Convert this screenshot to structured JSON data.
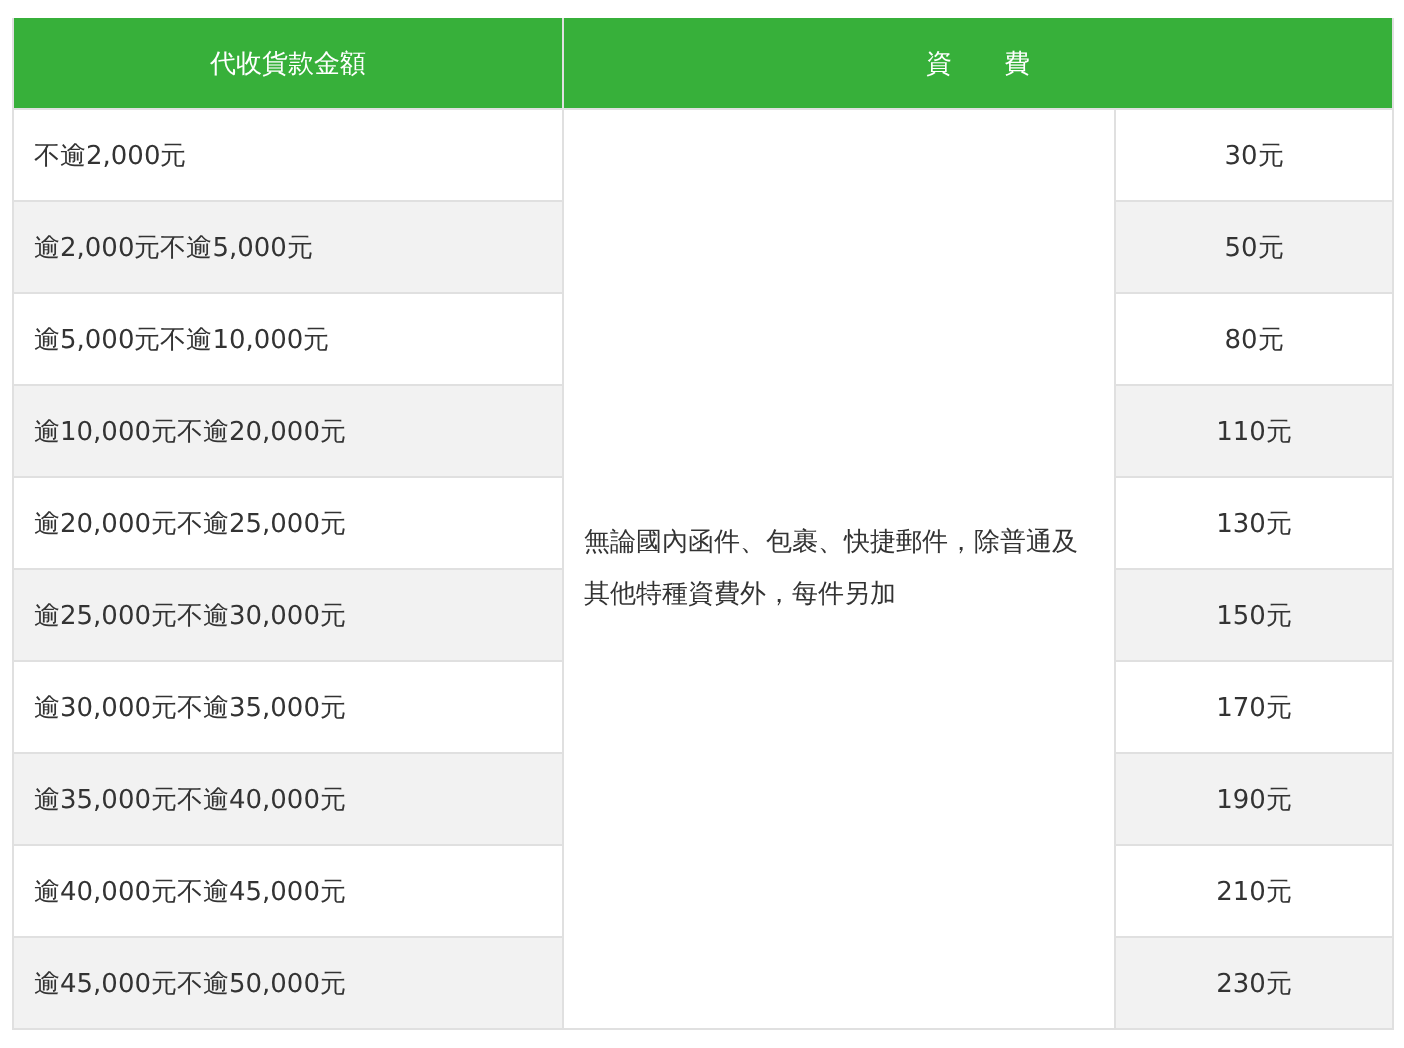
{
  "table": {
    "columns": [
      "代收貨款金額",
      "資　　費"
    ],
    "note": "無論國內函件、包裹、快捷郵件，除普通及其他特種資費外，每件另加",
    "rows": [
      {
        "range": "不逾2,000元",
        "fee": "30元"
      },
      {
        "range": "逾2,000元不逾5,000元",
        "fee": "50元"
      },
      {
        "range": "逾5,000元不逾10,000元",
        "fee": "80元"
      },
      {
        "range": "逾10,000元不逾20,000元",
        "fee": "110元"
      },
      {
        "range": "逾20,000元不逾25,000元",
        "fee": "130元"
      },
      {
        "range": "逾25,000元不逾30,000元",
        "fee": "150元"
      },
      {
        "range": "逾30,000元不逾35,000元",
        "fee": "170元"
      },
      {
        "range": "逾35,000元不逾40,000元",
        "fee": "190元"
      },
      {
        "range": "逾40,000元不逾45,000元",
        "fee": "210元"
      },
      {
        "range": "逾45,000元不逾50,000元",
        "fee": "230元"
      }
    ]
  }
}
